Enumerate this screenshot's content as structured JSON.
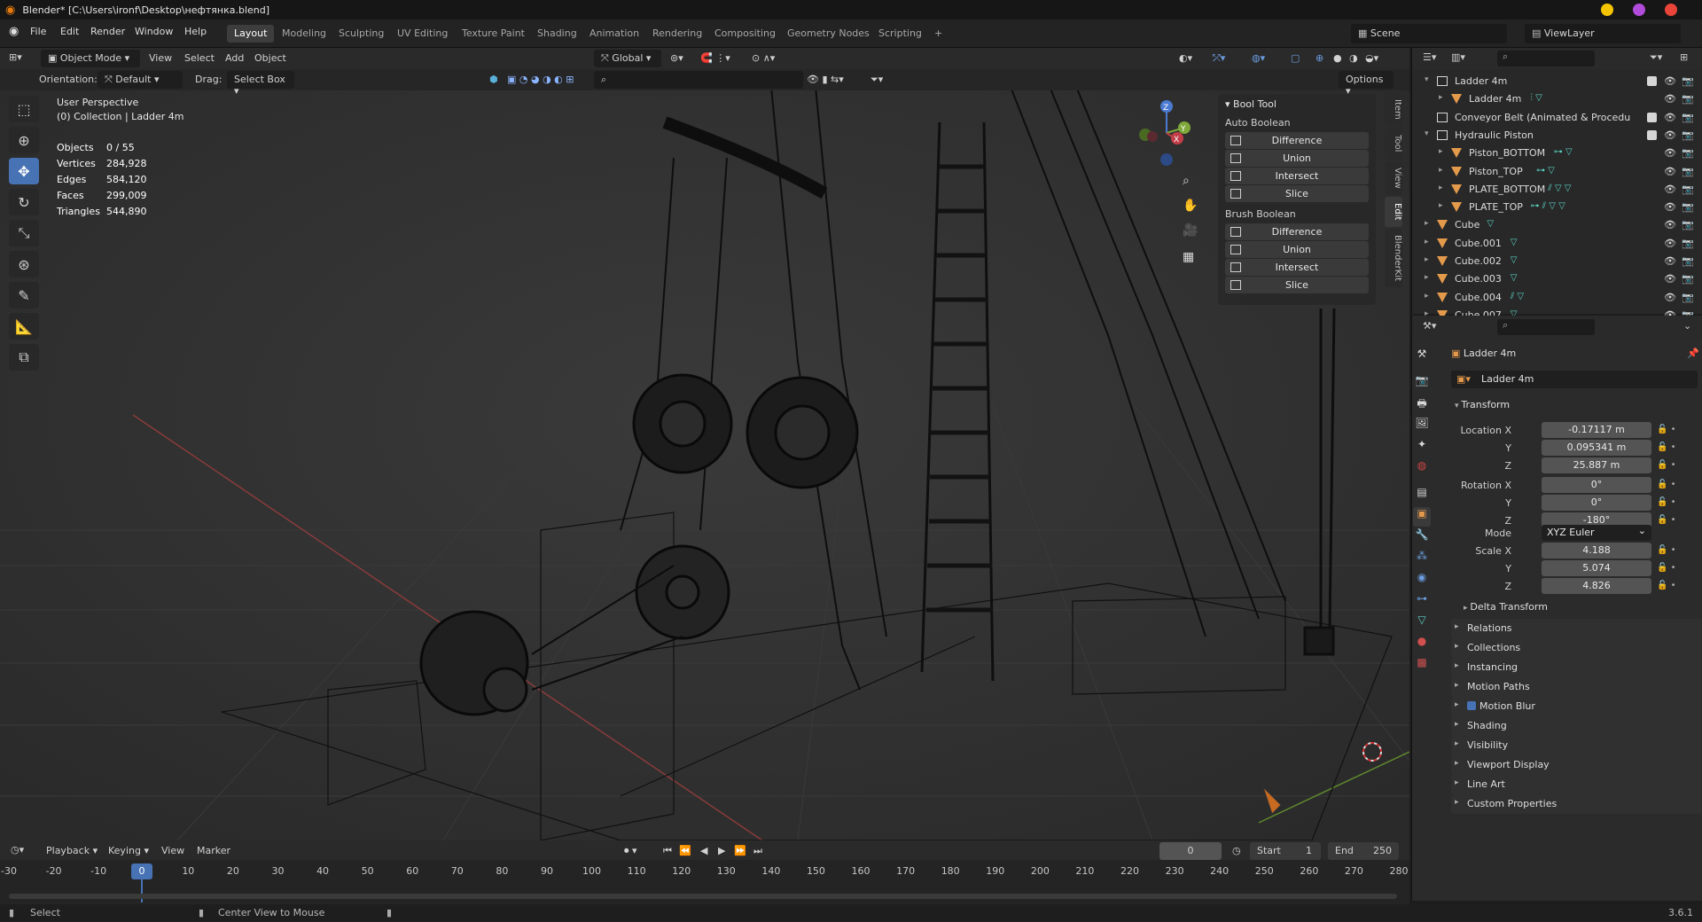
{
  "titlebar": {
    "title": "Blender* [C:\\Users\\ironf\\Desktop\\нефтянка.blend]"
  },
  "menu": [
    "File",
    "Edit",
    "Render",
    "Window",
    "Help"
  ],
  "workspaces": [
    "Layout",
    "Modeling",
    "Sculpting",
    "UV Editing",
    "Texture Paint",
    "Shading",
    "Animation",
    "Rendering",
    "Compositing",
    "Geometry Nodes",
    "Scripting",
    "+"
  ],
  "scene": {
    "scene_label": "Scene",
    "viewlayer_label": "ViewLayer"
  },
  "viewport_header": {
    "mode": "Object Mode",
    "menus": [
      "View",
      "Select",
      "Add",
      "Object"
    ],
    "transform": "Global",
    "orientation_label": "Orientation:",
    "orientation_value": "Default",
    "drag_label": "Drag:",
    "drag_value": "Select Box",
    "options": "Options"
  },
  "overlay": {
    "perspective": "User Perspective",
    "collection": "(0) Collection | Ladder 4m",
    "stats": [
      {
        "label": "Objects",
        "value": "0 / 55"
      },
      {
        "label": "Vertices",
        "value": "284,928"
      },
      {
        "label": "Edges",
        "value": "584,120"
      },
      {
        "label": "Faces",
        "value": "299,009"
      },
      {
        "label": "Triangles",
        "value": "544,890"
      }
    ]
  },
  "bool_tool": {
    "title": "Bool Tool",
    "auto_label": "Auto Boolean",
    "auto_buttons": [
      "Difference",
      "Union",
      "Intersect",
      "Slice"
    ],
    "brush_label": "Brush Boolean",
    "brush_buttons": [
      "Difference",
      "Union",
      "Intersect",
      "Slice"
    ]
  },
  "ntabs": [
    "Item",
    "Tool",
    "View",
    "Edit",
    "BlenderKit"
  ],
  "outliner": {
    "rows": [
      {
        "name": "Ladder 4m",
        "type": "collection",
        "indent": 0,
        "arrow": "▾"
      },
      {
        "name": "Ladder 4m",
        "type": "object",
        "indent": 1,
        "arrow": "▸"
      },
      {
        "name": "Conveyor Belt (Animated & Procedu",
        "type": "collection",
        "indent": 0,
        "arrow": ""
      },
      {
        "name": "Hydraulic Piston",
        "type": "collection",
        "indent": 0,
        "arrow": "▾"
      },
      {
        "name": "Piston_BOTTOM",
        "type": "object",
        "indent": 1,
        "arrow": "▸"
      },
      {
        "name": "Piston_TOP",
        "type": "object",
        "indent": 1,
        "arrow": "▸"
      },
      {
        "name": "PLATE_BOTTOM",
        "type": "object",
        "indent": 1,
        "arrow": "▸"
      },
      {
        "name": "PLATE_TOP",
        "type": "object",
        "indent": 1,
        "arrow": "▸"
      },
      {
        "name": "Cube",
        "type": "object",
        "indent": 0,
        "arrow": "▸"
      },
      {
        "name": "Cube.001",
        "type": "object",
        "indent": 0,
        "arrow": "▸"
      },
      {
        "name": "Cube.002",
        "type": "object",
        "indent": 0,
        "arrow": "▸"
      },
      {
        "name": "Cube.003",
        "type": "object",
        "indent": 0,
        "arrow": "▸"
      },
      {
        "name": "Cube.004",
        "type": "object",
        "indent": 0,
        "arrow": "▸"
      },
      {
        "name": "Cube.007",
        "type": "object",
        "indent": 0,
        "arrow": "▸"
      }
    ]
  },
  "properties": {
    "object_name": "Ladder 4m",
    "data_name": "Ladder 4m",
    "transform_label": "Transform",
    "location": [
      {
        "label": "Location X",
        "value": "-0.17117 m"
      },
      {
        "label": "Y",
        "value": "0.095341 m"
      },
      {
        "label": "Z",
        "value": "25.887 m"
      }
    ],
    "rotation": [
      {
        "label": "Rotation X",
        "value": "0°"
      },
      {
        "label": "Y",
        "value": "0°"
      },
      {
        "label": "Z",
        "value": "-180°"
      }
    ],
    "mode_label": "Mode",
    "mode_value": "XYZ Euler",
    "scale": [
      {
        "label": "Scale X",
        "value": "4.188"
      },
      {
        "label": "Y",
        "value": "5.074"
      },
      {
        "label": "Z",
        "value": "4.826"
      }
    ],
    "delta": "Delta Transform",
    "sections": [
      "Relations",
      "Collections",
      "Instancing",
      "Motion Paths",
      "Motion Blur",
      "Shading",
      "Visibility",
      "Viewport Display",
      "Line Art",
      "Custom Properties"
    ]
  },
  "timeline": {
    "menus": [
      "Playback",
      "Keying",
      "View",
      "Marker"
    ],
    "current_frame": "0",
    "start_label": "Start",
    "start": "1",
    "end_label": "End",
    "end": "250",
    "marker": "0",
    "ticks": [
      "-30",
      "-20",
      "-10",
      "0",
      "10",
      "20",
      "30",
      "40",
      "50",
      "60",
      "70",
      "80",
      "90",
      "100",
      "110",
      "120",
      "130",
      "140",
      "150",
      "160",
      "170",
      "180",
      "190",
      "200",
      "210",
      "220",
      "230",
      "240",
      "250",
      "260",
      "270",
      "280"
    ]
  },
  "status": {
    "select": "Select",
    "center": "Center View to Mouse",
    "version": "3.6.1"
  },
  "colors": {
    "accent": "#4772b3",
    "object_icon": "#e49a4b",
    "modifier": "#5ad1c3"
  }
}
